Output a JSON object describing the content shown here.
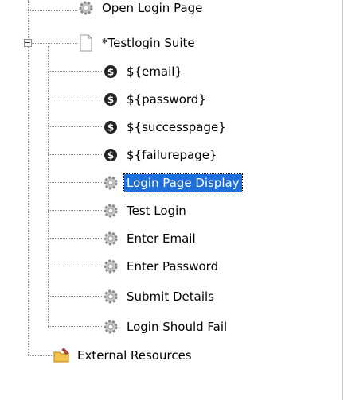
{
  "tree": {
    "open_login_page": "Open Login Page",
    "suite": {
      "label": "*Testlogin Suite",
      "toggle": "collapse"
    },
    "variables": [
      {
        "label": "${email}"
      },
      {
        "label": "${password}"
      },
      {
        "label": "${successpage}"
      },
      {
        "label": "${failurepage}"
      }
    ],
    "keywords": [
      {
        "label": "Login Page Display",
        "selected": true
      },
      {
        "label": "Test Login"
      },
      {
        "label": "Enter Email"
      },
      {
        "label": "Enter Password"
      },
      {
        "label": "Submit Details"
      },
      {
        "label": "Login Should Fail"
      }
    ],
    "external_resources": "External Resources"
  },
  "colors": {
    "selection": "#1e6fd9",
    "tree_line": "#8a8a8a"
  }
}
